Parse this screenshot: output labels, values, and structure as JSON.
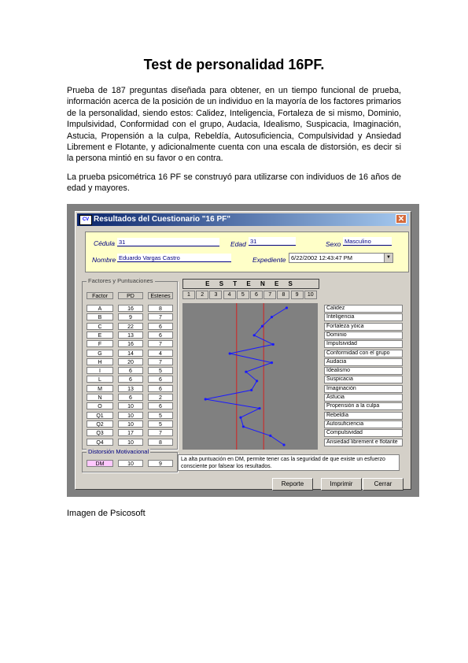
{
  "document": {
    "title": "Test de personalidad 16PF.",
    "paragraph1": "Prueba de 187 preguntas diseñada para obtener, en un tiempo funcional de prueba, información acerca de la posición de un individuo en la mayoría de los factores primarios de la personalidad, siendo estos: Calidez, Inteligencia, Fortaleza de si mismo, Dominio, Impulsividad, Conformidad con el grupo, Audacia, Idealismo, Suspicacia, Imaginación, Astucia, Propensión a la culpa, Rebeldía, Autosuficiencia, Compulsividad y Ansiedad Librement e Flotante, y adicionalmente cuenta con una escala de distorsión, es decir si la persona mintió en su favor o en contra.",
    "paragraph2": "La prueba psicométrica 16 PF se construyó para utilizarse con individuos de 16 años de edad y mayores.",
    "caption": "Imagen de Psicosoft"
  },
  "window": {
    "icon": "app-icon",
    "icon_text": "CV",
    "title": "Resultados del Cuestionario \"16 PF\"",
    "close_glyph": "✕"
  },
  "header": {
    "cedula_label": "Cédula",
    "cedula_value": "31",
    "edad_label": "Edad",
    "edad_value": "31",
    "sexo_label": "Sexo",
    "sexo_value": "Masculino",
    "nombre_label": "Nombre",
    "nombre_value": "Eduardo Vargas Castro",
    "expediente_label": "Expediente",
    "expediente_value": "6/22/2002 12:43:47 PM"
  },
  "factors": {
    "group_title": "Factores y Puntuaciones",
    "columns": [
      "Factor",
      "PD",
      "Estenes"
    ],
    "rows": [
      [
        "A",
        "16",
        "8"
      ],
      [
        "B",
        "9",
        "7"
      ],
      [
        "C",
        "22",
        "6"
      ],
      [
        "E",
        "13",
        "6"
      ],
      [
        "F",
        "16",
        "7"
      ],
      [
        "G",
        "14",
        "4"
      ],
      [
        "H",
        "20",
        "7"
      ],
      [
        "I",
        "6",
        "5"
      ],
      [
        "L",
        "6",
        "6"
      ],
      [
        "M",
        "13",
        "6"
      ],
      [
        "N",
        "6",
        "2"
      ],
      [
        "O",
        "10",
        "6"
      ],
      [
        "Q1",
        "10",
        "5"
      ],
      [
        "Q2",
        "10",
        "5"
      ],
      [
        "Q3",
        "17",
        "7"
      ],
      [
        "Q4",
        "10",
        "8"
      ]
    ]
  },
  "estenes": {
    "title": "E S T E N E S",
    "scale": [
      "1",
      "2",
      "3",
      "4",
      "5",
      "6",
      "7",
      "8",
      "9",
      "10"
    ],
    "reference_lines": [
      4.5,
      6.5
    ],
    "profile": [
      8.2,
      7.1,
      6.4,
      5.8,
      7.2,
      4.0,
      7.1,
      5.2,
      6.0,
      5.6,
      2.2,
      6.2,
      4.8,
      5.0,
      7.0,
      8.0
    ]
  },
  "traits": [
    "Calidez",
    "Inteligencia",
    "Fortaleza yóica",
    "Dominio",
    "Impulsividad",
    "Conformidad con el grupo",
    "Audacia",
    "Idealismo",
    "Suspicacia",
    "Imaginación",
    "Astucia",
    "Propensión a la culpa",
    "Rebeldía",
    "Autosuficiencia",
    "Compulsividad",
    "Ansiedad librement e flotante"
  ],
  "distortion": {
    "group_title": "Distorsión Motivacional",
    "factor": "DM",
    "pd": "10",
    "estenes": "9",
    "message": "La alta puntuación en DM, permite tener cas la seguridad de que existe un esfuerzo consciente por falsear los resultados."
  },
  "buttons": {
    "reporte": "Reporte",
    "imprimir": "Imprimir",
    "cerrar": "Cerrar"
  },
  "colors": {
    "titlebar": "#0a246a",
    "header_panel": "#ffffc8",
    "plot_background": "#808080",
    "profile_line": "#1a1aff",
    "reference_line": "#d42020"
  }
}
